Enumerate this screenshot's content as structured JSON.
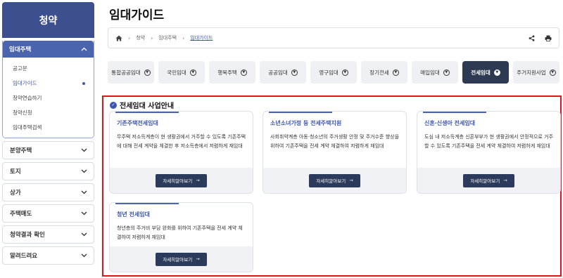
{
  "sidebar": {
    "header": "청약",
    "open_menu": {
      "label": "임대주택",
      "items": [
        {
          "label": "공고문",
          "active": false
        },
        {
          "label": "임대가이드",
          "active": true
        },
        {
          "label": "청약연습하기",
          "active": false
        },
        {
          "label": "청약신청",
          "active": false
        },
        {
          "label": "임대주택검색",
          "active": false
        }
      ]
    },
    "closed_menus": [
      "분양주택",
      "토지",
      "상가",
      "주택매도",
      "청약결과 확인",
      "알려드려요"
    ]
  },
  "page": {
    "title": "임대가이드"
  },
  "breadcrumb": {
    "home_icon": "home-icon",
    "items": [
      "청약",
      "임대주택",
      "임대가이드"
    ],
    "share_icon": "share-icon",
    "print_icon": "print-icon"
  },
  "tabs": [
    {
      "label": "통합공공임대",
      "active": false
    },
    {
      "label": "국민임대",
      "active": false
    },
    {
      "label": "행복주택",
      "active": false
    },
    {
      "label": "공공임대",
      "active": false
    },
    {
      "label": "영구임대",
      "active": false
    },
    {
      "label": "장기전세",
      "active": false
    },
    {
      "label": "매입임대",
      "active": false
    },
    {
      "label": "전세임대",
      "active": true
    },
    {
      "label": "주거지원사업",
      "active": false
    }
  ],
  "section": {
    "title": "전세임대 사업안내"
  },
  "cards": [
    {
      "title": "기존주택전세임대",
      "desc": "무주택 저소득계층이 현 생활권에서 거주할 수 있도록 기존주택에 대해 전세 계약을 체결한 후 저소득층에서 저렴하게 재임대",
      "button": "자세히알아보기"
    },
    {
      "title": "소년소녀가정 등 전세주택지원",
      "desc": "사회취약계층 아동·청소년의 주거생활 안정 및 주거수준 향상을 위하여 기존주택을 전세 계약 체결하여 저렴하게 재임대",
      "button": "자세히알아보기"
    },
    {
      "title": "신혼·신생아 전세임대",
      "desc": "도심 내 저소득계층 신혼부부가 현 생활권에서 안정적으로 거주할 수 있도록 기존주택을 전세 계약 체결하여 저렴하게 재임대",
      "button": "자세히알아보기"
    },
    {
      "title": "청년 전세임대",
      "desc": "청년층의 주거비 부담 완화를 위하여 기존주택을 전세 계약 체결하여 저렴하게 재임대",
      "button": "자세히알아보기"
    }
  ],
  "colors": {
    "sidebar_header": "#3d4f8f",
    "accent": "#3d57b0",
    "active_tab": "#2e3a52",
    "highlight_border": "#e0141d"
  }
}
